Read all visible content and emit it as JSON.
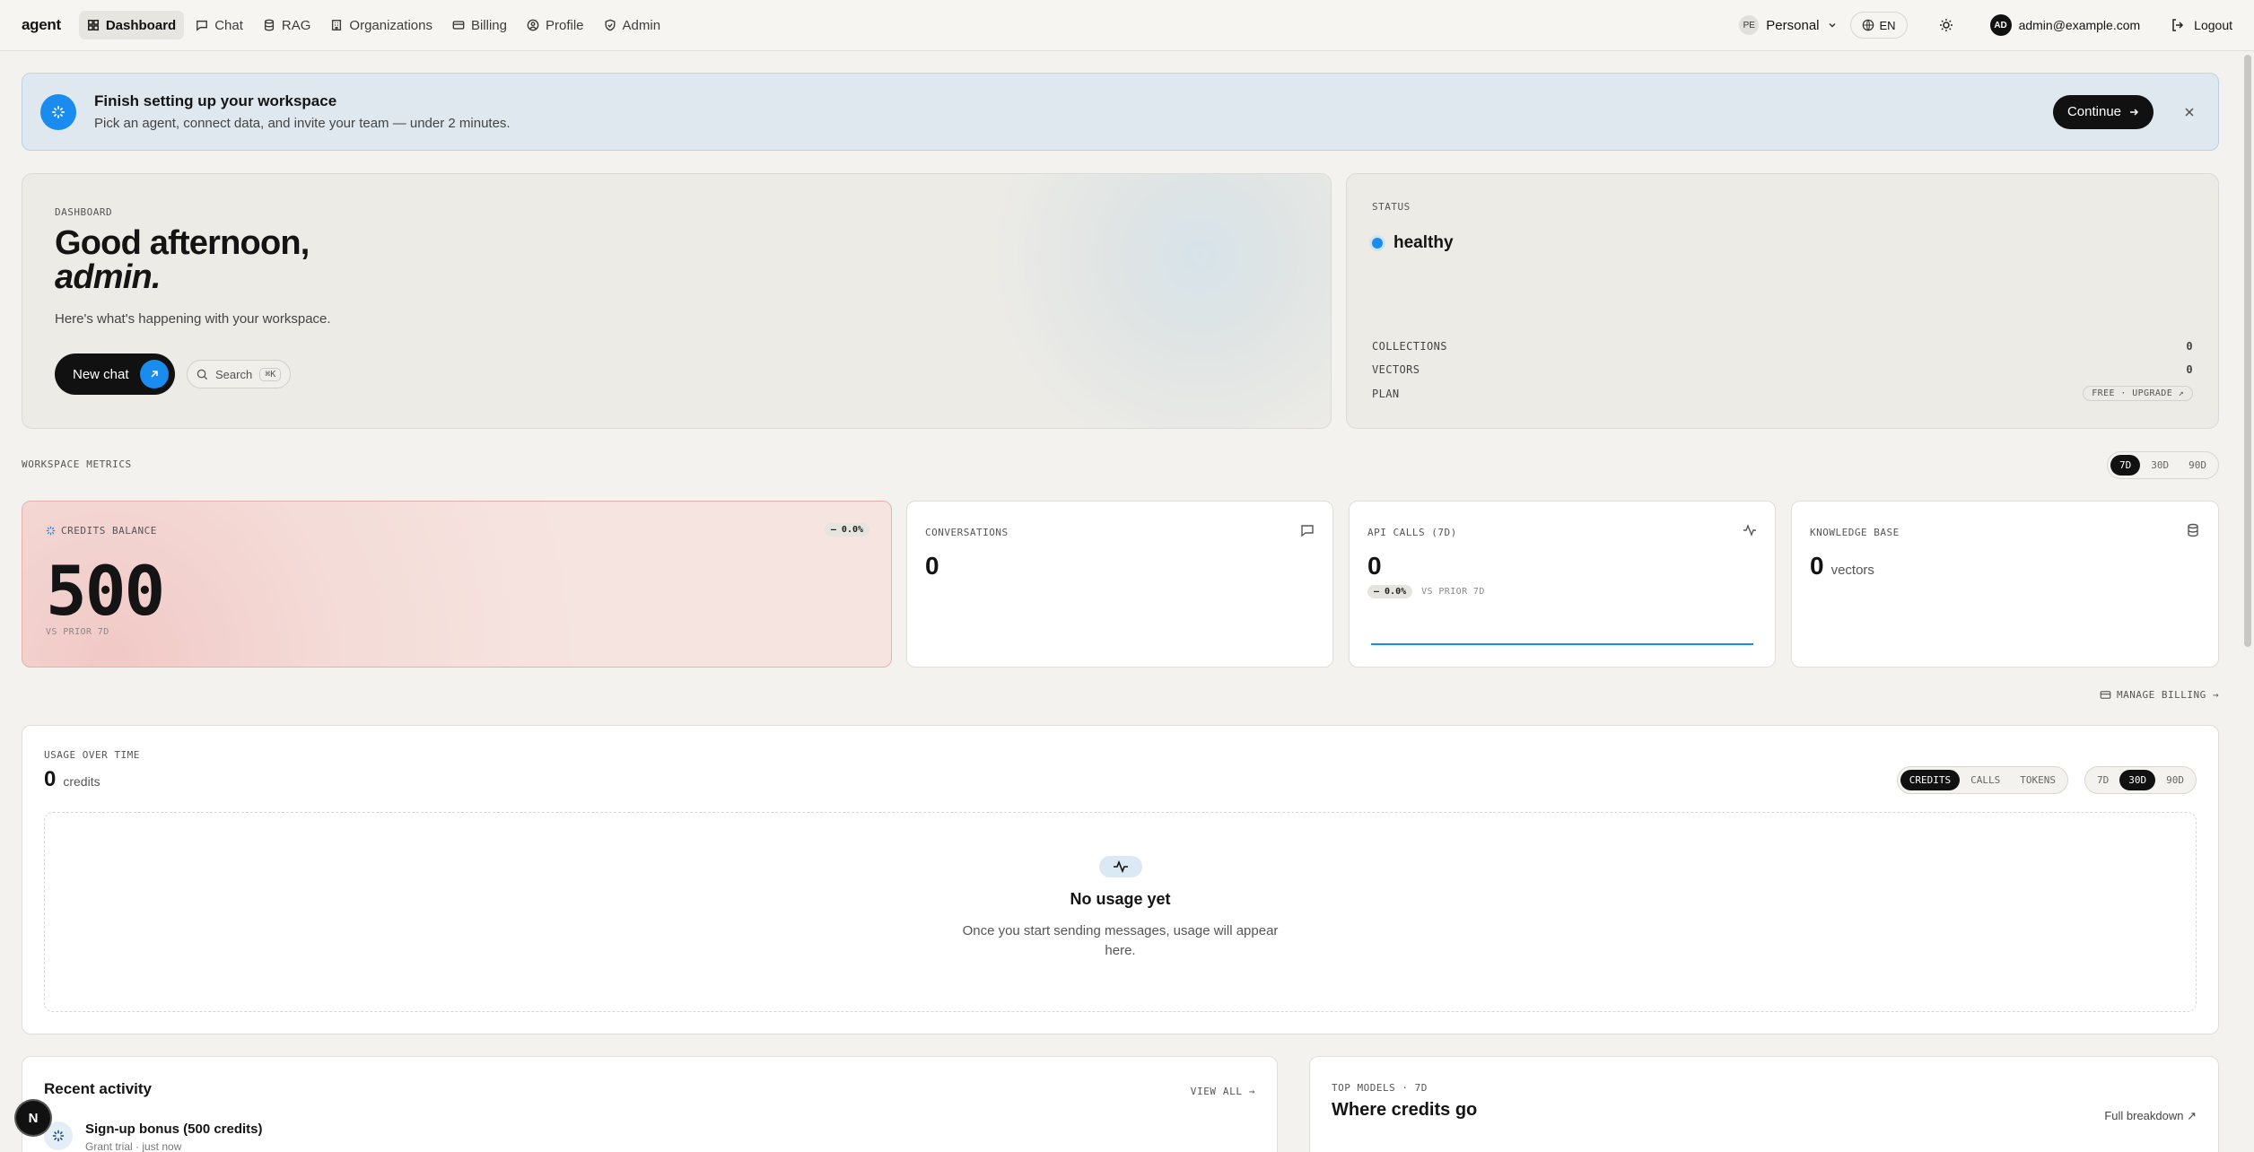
{
  "nav": {
    "brand": "agent",
    "items": [
      {
        "label": "Dashboard",
        "icon": "grid-icon",
        "active": true
      },
      {
        "label": "Chat",
        "icon": "chat-icon"
      },
      {
        "label": "RAG",
        "icon": "database-icon"
      },
      {
        "label": "Organizations",
        "icon": "building-icon"
      },
      {
        "label": "Billing",
        "icon": "card-icon"
      },
      {
        "label": "Profile",
        "icon": "user-circle-icon"
      },
      {
        "label": "Admin",
        "icon": "shield-icon"
      }
    ],
    "workspace_avatar": "PE",
    "workspace": "Personal",
    "lang": "EN",
    "user_avatar": "AD",
    "user_email": "admin@example.com",
    "logout": "Logout"
  },
  "banner": {
    "title": "Finish setting up your workspace",
    "text": "Pick an agent, connect data, and invite your team — under 2 minutes.",
    "continue": "Continue"
  },
  "hero": {
    "eyebrow": "DASHBOARD",
    "greeting": "Good afternoon,",
    "name": "admin.",
    "sub": "Here's what's happening with your workspace.",
    "new_chat": "New chat",
    "search": "Search",
    "search_kbd": "⌘K"
  },
  "status": {
    "label": "STATUS",
    "value": "healthy",
    "collections_label": "COLLECTIONS",
    "collections": "0",
    "vectors_label": "VECTORS",
    "vectors": "0",
    "plan_label": "PLAN",
    "plan": "FREE · UPGRADE ↗"
  },
  "metrics": {
    "label": "WORKSPACE METRICS",
    "ranges": [
      "7D",
      "30D",
      "90D"
    ],
    "credits": {
      "title": "CREDITS BALANCE",
      "value": "500",
      "delta": "— 0.0%",
      "vs": "VS PRIOR 7D"
    },
    "conversations": {
      "title": "CONVERSATIONS",
      "value": "0"
    },
    "api": {
      "title": "API CALLS (7D)",
      "value": "0",
      "delta": "— 0.0%",
      "vs": "VS PRIOR 7D"
    },
    "kb": {
      "title": "KNOWLEDGE BASE",
      "value": "0",
      "unit": "vectors"
    },
    "manage_billing": "MANAGE BILLING →"
  },
  "usage": {
    "title": "USAGE OVER TIME",
    "value": "0",
    "unit": "credits",
    "modes": [
      "CREDITS",
      "CALLS",
      "TOKENS"
    ],
    "ranges": [
      "7D",
      "30D",
      "90D"
    ],
    "empty_title": "No usage yet",
    "empty_text": "Once you start sending messages, usage will appear here."
  },
  "recent": {
    "title": "Recent activity",
    "view_all": "VIEW ALL →",
    "item_name": "Sign-up bonus (500 credits)",
    "item_sub": "Grant trial · just now"
  },
  "models": {
    "eyebrow": "TOP MODELS · 7D",
    "title": "Where credits go",
    "breakdown": "Full breakdown ↗"
  },
  "badge": "N",
  "colors": {
    "accent": "#1a8cf0",
    "dark": "#111111",
    "credits_bg": "#f6e4e1"
  }
}
